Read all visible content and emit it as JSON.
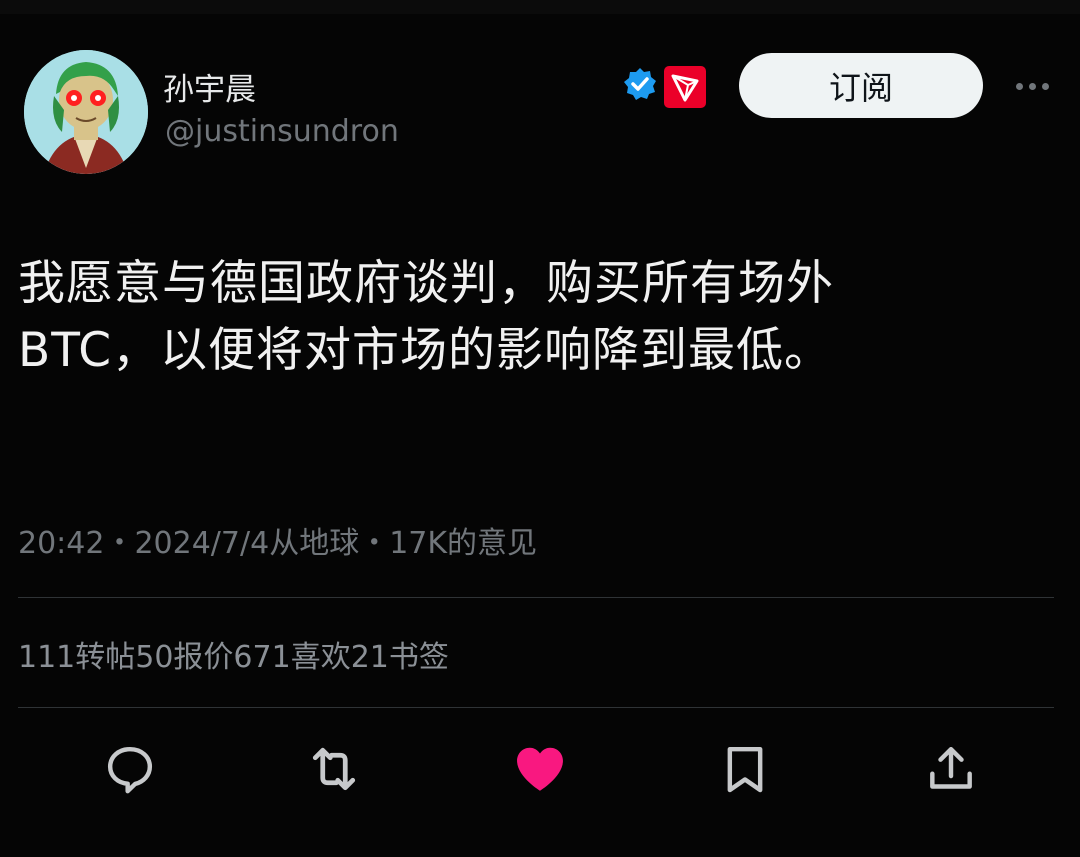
{
  "user": {
    "display_name": "孙宇晨",
    "handle": "@justinsundron"
  },
  "badges": {
    "verified_icon": "verified-badge-icon",
    "affiliate_icon": "tron-logo-icon"
  },
  "header": {
    "subscribe_label": "订阅",
    "more_icon": "more-horizontal-icon"
  },
  "tweet": {
    "lines": [
      "我愿意与德国政府谈判，购买所有场外",
      "BTC，以便将对市场的影响降到最低。"
    ]
  },
  "meta": {
    "text": "20:42・2024/7/4从地球・17K的意见"
  },
  "stats": {
    "text": "111转帖50报价671喜欢21书签"
  },
  "actions": [
    {
      "icon": "reply-icon"
    },
    {
      "icon": "retweet-icon"
    },
    {
      "icon": "like-icon",
      "active": true
    },
    {
      "icon": "bookmark-icon"
    },
    {
      "icon": "share-icon"
    }
  ],
  "colors": {
    "background": "#000000",
    "text": "#e7e9ea",
    "muted": "#71767b",
    "like_active": "#f91880",
    "verified_blue": "#1d9bf0",
    "tron_red": "#eb0029"
  }
}
